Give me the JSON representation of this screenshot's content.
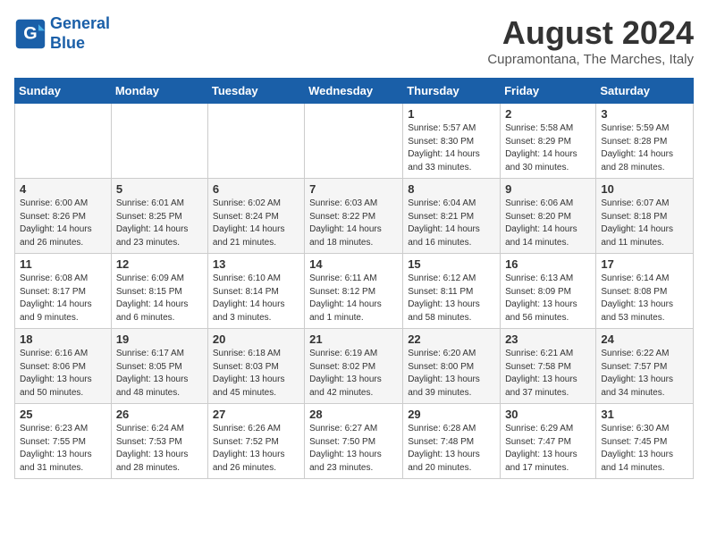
{
  "header": {
    "logo_line1": "General",
    "logo_line2": "Blue",
    "month_title": "August 2024",
    "subtitle": "Cupramontana, The Marches, Italy"
  },
  "weekdays": [
    "Sunday",
    "Monday",
    "Tuesday",
    "Wednesday",
    "Thursday",
    "Friday",
    "Saturday"
  ],
  "weeks": [
    [
      {
        "day": "",
        "info": ""
      },
      {
        "day": "",
        "info": ""
      },
      {
        "day": "",
        "info": ""
      },
      {
        "day": "",
        "info": ""
      },
      {
        "day": "1",
        "info": "Sunrise: 5:57 AM\nSunset: 8:30 PM\nDaylight: 14 hours\nand 33 minutes."
      },
      {
        "day": "2",
        "info": "Sunrise: 5:58 AM\nSunset: 8:29 PM\nDaylight: 14 hours\nand 30 minutes."
      },
      {
        "day": "3",
        "info": "Sunrise: 5:59 AM\nSunset: 8:28 PM\nDaylight: 14 hours\nand 28 minutes."
      }
    ],
    [
      {
        "day": "4",
        "info": "Sunrise: 6:00 AM\nSunset: 8:26 PM\nDaylight: 14 hours\nand 26 minutes."
      },
      {
        "day": "5",
        "info": "Sunrise: 6:01 AM\nSunset: 8:25 PM\nDaylight: 14 hours\nand 23 minutes."
      },
      {
        "day": "6",
        "info": "Sunrise: 6:02 AM\nSunset: 8:24 PM\nDaylight: 14 hours\nand 21 minutes."
      },
      {
        "day": "7",
        "info": "Sunrise: 6:03 AM\nSunset: 8:22 PM\nDaylight: 14 hours\nand 18 minutes."
      },
      {
        "day": "8",
        "info": "Sunrise: 6:04 AM\nSunset: 8:21 PM\nDaylight: 14 hours\nand 16 minutes."
      },
      {
        "day": "9",
        "info": "Sunrise: 6:06 AM\nSunset: 8:20 PM\nDaylight: 14 hours\nand 14 minutes."
      },
      {
        "day": "10",
        "info": "Sunrise: 6:07 AM\nSunset: 8:18 PM\nDaylight: 14 hours\nand 11 minutes."
      }
    ],
    [
      {
        "day": "11",
        "info": "Sunrise: 6:08 AM\nSunset: 8:17 PM\nDaylight: 14 hours\nand 9 minutes."
      },
      {
        "day": "12",
        "info": "Sunrise: 6:09 AM\nSunset: 8:15 PM\nDaylight: 14 hours\nand 6 minutes."
      },
      {
        "day": "13",
        "info": "Sunrise: 6:10 AM\nSunset: 8:14 PM\nDaylight: 14 hours\nand 3 minutes."
      },
      {
        "day": "14",
        "info": "Sunrise: 6:11 AM\nSunset: 8:12 PM\nDaylight: 14 hours\nand 1 minute."
      },
      {
        "day": "15",
        "info": "Sunrise: 6:12 AM\nSunset: 8:11 PM\nDaylight: 13 hours\nand 58 minutes."
      },
      {
        "day": "16",
        "info": "Sunrise: 6:13 AM\nSunset: 8:09 PM\nDaylight: 13 hours\nand 56 minutes."
      },
      {
        "day": "17",
        "info": "Sunrise: 6:14 AM\nSunset: 8:08 PM\nDaylight: 13 hours\nand 53 minutes."
      }
    ],
    [
      {
        "day": "18",
        "info": "Sunrise: 6:16 AM\nSunset: 8:06 PM\nDaylight: 13 hours\nand 50 minutes."
      },
      {
        "day": "19",
        "info": "Sunrise: 6:17 AM\nSunset: 8:05 PM\nDaylight: 13 hours\nand 48 minutes."
      },
      {
        "day": "20",
        "info": "Sunrise: 6:18 AM\nSunset: 8:03 PM\nDaylight: 13 hours\nand 45 minutes."
      },
      {
        "day": "21",
        "info": "Sunrise: 6:19 AM\nSunset: 8:02 PM\nDaylight: 13 hours\nand 42 minutes."
      },
      {
        "day": "22",
        "info": "Sunrise: 6:20 AM\nSunset: 8:00 PM\nDaylight: 13 hours\nand 39 minutes."
      },
      {
        "day": "23",
        "info": "Sunrise: 6:21 AM\nSunset: 7:58 PM\nDaylight: 13 hours\nand 37 minutes."
      },
      {
        "day": "24",
        "info": "Sunrise: 6:22 AM\nSunset: 7:57 PM\nDaylight: 13 hours\nand 34 minutes."
      }
    ],
    [
      {
        "day": "25",
        "info": "Sunrise: 6:23 AM\nSunset: 7:55 PM\nDaylight: 13 hours\nand 31 minutes."
      },
      {
        "day": "26",
        "info": "Sunrise: 6:24 AM\nSunset: 7:53 PM\nDaylight: 13 hours\nand 28 minutes."
      },
      {
        "day": "27",
        "info": "Sunrise: 6:26 AM\nSunset: 7:52 PM\nDaylight: 13 hours\nand 26 minutes."
      },
      {
        "day": "28",
        "info": "Sunrise: 6:27 AM\nSunset: 7:50 PM\nDaylight: 13 hours\nand 23 minutes."
      },
      {
        "day": "29",
        "info": "Sunrise: 6:28 AM\nSunset: 7:48 PM\nDaylight: 13 hours\nand 20 minutes."
      },
      {
        "day": "30",
        "info": "Sunrise: 6:29 AM\nSunset: 7:47 PM\nDaylight: 13 hours\nand 17 minutes."
      },
      {
        "day": "31",
        "info": "Sunrise: 6:30 AM\nSunset: 7:45 PM\nDaylight: 13 hours\nand 14 minutes."
      }
    ]
  ]
}
